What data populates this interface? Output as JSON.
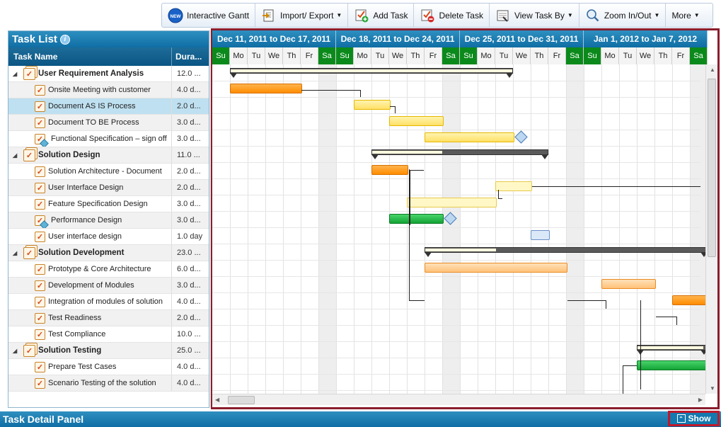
{
  "toolbar": {
    "interactive_gantt": "Interactive Gantt",
    "new_badge": "NEW",
    "import_export": "Import/ Export",
    "add_task": "Add Task",
    "delete_task": "Delete Task",
    "view_task_by": "View Task By",
    "zoom": "Zoom In/Out",
    "more": "More"
  },
  "task_list": {
    "title": "Task List",
    "col_name": "Task Name",
    "col_duration": "Dura...",
    "rows": [
      {
        "name": "User Requirement Analysis",
        "duration": "12.0 ...",
        "group": true
      },
      {
        "name": "Onsite Meeting with customer",
        "duration": "4.0 d..."
      },
      {
        "name": "Document AS IS Process",
        "duration": "2.0 d...",
        "selected": true
      },
      {
        "name": "Document TO BE Process",
        "duration": "3.0 d..."
      },
      {
        "name": "Functional Specification – sign off",
        "duration": "3.0 d...",
        "milestone": true
      },
      {
        "name": "Solution Design",
        "duration": "11.0 ...",
        "group": true
      },
      {
        "name": "Solution Architecture - Document",
        "duration": "2.0 d..."
      },
      {
        "name": "User Interface Design",
        "duration": "2.0 d..."
      },
      {
        "name": "Feature Specification Design",
        "duration": "3.0 d..."
      },
      {
        "name": "Performance Design",
        "duration": "3.0 d...",
        "milestone": true
      },
      {
        "name": "User interface design",
        "duration": "1.0 day"
      },
      {
        "name": "Solution Development",
        "duration": "23.0 ...",
        "group": true
      },
      {
        "name": "Prototype & Core Architecture",
        "duration": "6.0 d..."
      },
      {
        "name": "Development of Modules",
        "duration": "3.0 d..."
      },
      {
        "name": "Integration of modules of solution",
        "duration": "4.0 d..."
      },
      {
        "name": "Test Readiness",
        "duration": "2.0 d..."
      },
      {
        "name": "Test Compliance",
        "duration": "10.0 ..."
      },
      {
        "name": "Solution Testing",
        "duration": "25.0 ...",
        "group": true
      },
      {
        "name": "Prepare Test Cases",
        "duration": "4.0 d..."
      },
      {
        "name": "Scenario Testing of the solution",
        "duration": "4.0 d..."
      }
    ]
  },
  "gantt": {
    "weeks": [
      "Dec 11, 2011 to Dec 17, 2011",
      "Dec 18, 2011 to Dec 24, 2011",
      "Dec 25, 2011 to Dec 31, 2011",
      "Jan 1, 2012 to Jan 7, 2012"
    ],
    "day_labels": [
      "Su",
      "Mo",
      "Tu",
      "We",
      "Th",
      "Fr",
      "Sa"
    ]
  },
  "detail_panel": {
    "title": "Task Detail Panel",
    "show_label": "Show"
  },
  "colors": {
    "header_blue": "#0f6ea4",
    "weekend_green": "#0b8a1b",
    "frame_red": "#8a1d2c"
  }
}
